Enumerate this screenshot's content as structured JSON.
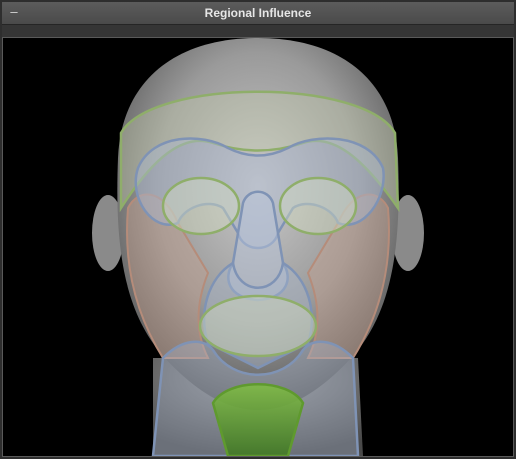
{
  "panel": {
    "title": "Regional Influence",
    "collapse_glyph": "–"
  },
  "viewport": {
    "content": "3d-head-model",
    "regions": [
      {
        "name": "forehead",
        "color": "#8fae6a"
      },
      {
        "name": "brow-eye-socket",
        "color": "#7f93b5"
      },
      {
        "name": "left-eye",
        "color": "#8fae6a"
      },
      {
        "name": "right-eye",
        "color": "#8fae6a"
      },
      {
        "name": "nose",
        "color": "#7f93b5"
      },
      {
        "name": "left-cheek",
        "color": "#b58c7a"
      },
      {
        "name": "right-cheek",
        "color": "#b58c7a"
      },
      {
        "name": "mouth",
        "color": "#8fae6a"
      },
      {
        "name": "muzzle",
        "color": "#7f93b5"
      },
      {
        "name": "jaw",
        "color": "#7f93b5"
      },
      {
        "name": "chin",
        "color": "#5f9a2e"
      }
    ]
  }
}
